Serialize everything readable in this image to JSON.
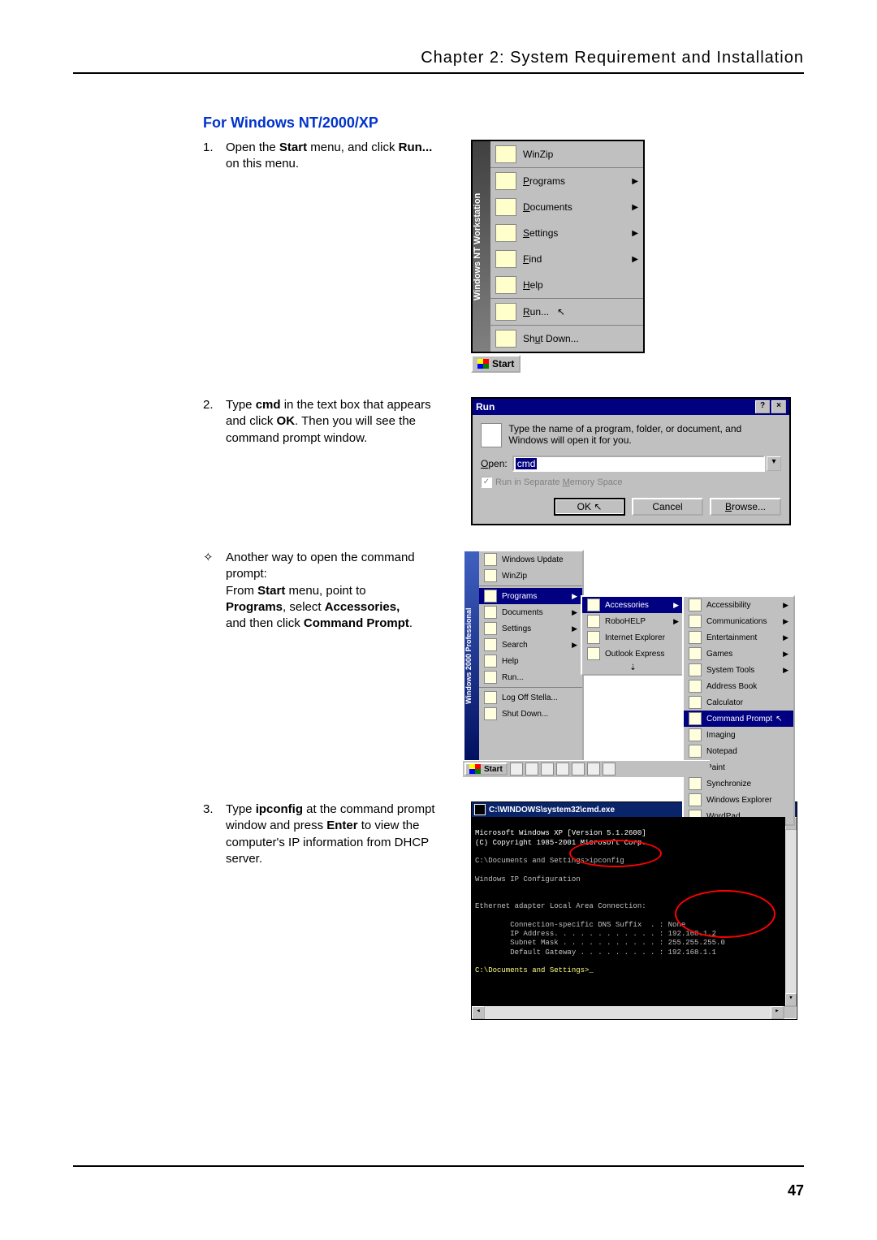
{
  "header": {
    "chapter": "Chapter 2: System Requirement and Installation"
  },
  "section": {
    "title": "For Windows NT/2000/XP"
  },
  "steps": {
    "s1": {
      "num": "1.",
      "pre": "Open the ",
      "b1": "Start",
      "mid": " menu, and click ",
      "b2": "Run...",
      "post": " on this menu."
    },
    "s2": {
      "num": "2.",
      "pre": "Type ",
      "b1": "cmd",
      "mid1": " in the text box that appears and click ",
      "b2": "OK",
      "post": ". Then you will see the command prompt window."
    },
    "tip": {
      "mark": "✧",
      "l1": "Another way to open the command prompt:",
      "l2a": "From ",
      "l2b": "Start",
      "l2c": " menu, point to ",
      "l3a": "Programs",
      "l3b": ", select ",
      "l3c": "Accessories,",
      "l4a": " and then click ",
      "l4b": "Command Prompt",
      "l4c": "."
    },
    "s3": {
      "num": "3.",
      "pre": "Type ",
      "b1": "ipconfig",
      "mid1": " at the command prompt window and press ",
      "b2": "Enter",
      "post": " to view the computer's IP information from DHCP server."
    }
  },
  "nt_menu": {
    "stripe": "Windows NT Workstation",
    "items": [
      {
        "label": "WinZip",
        "arrow": false
      },
      {
        "label": "Programs",
        "arrow": true,
        "ul": "P"
      },
      {
        "label": "Documents",
        "arrow": true,
        "ul": "D"
      },
      {
        "label": "Settings",
        "arrow": true,
        "ul": "S"
      },
      {
        "label": "Find",
        "arrow": true,
        "ul": "F"
      },
      {
        "label": "Help",
        "arrow": false,
        "ul": "H"
      },
      {
        "label": "Run...",
        "arrow": false,
        "ul": "R"
      },
      {
        "label": "Shut Down...",
        "arrow": false,
        "ul": "u"
      }
    ],
    "start": "Start"
  },
  "run": {
    "title": "Run",
    "help": "?",
    "close": "×",
    "desc": "Type the name of a program, folder, or document, and Windows will open it for you.",
    "open_label": "Open:",
    "open_ul": "O",
    "value": "cmd",
    "memchk": "Run in Separate Memory Space",
    "memchk_ul": "M",
    "ok": "OK",
    "cancel": "Cancel",
    "browse": "Browse...",
    "browse_ul": "B"
  },
  "w2k": {
    "stripe": "Windows 2000 Professional",
    "top": [
      {
        "label": "Windows Update"
      },
      {
        "label": "WinZip"
      }
    ],
    "main": [
      {
        "label": "Programs",
        "hi": true,
        "arrow": true
      },
      {
        "label": "Documents",
        "arrow": true
      },
      {
        "label": "Settings",
        "arrow": true
      },
      {
        "label": "Search",
        "arrow": true
      },
      {
        "label": "Help"
      },
      {
        "label": "Run..."
      },
      {
        "label": "Log Off Stella..."
      },
      {
        "label": "Shut Down..."
      }
    ],
    "programs": [
      {
        "label": "Accessories",
        "hi": true,
        "arrow": true
      },
      {
        "label": "RoboHELP",
        "arrow": true
      },
      {
        "label": "Internet Explorer"
      },
      {
        "label": "Outlook Express"
      },
      {
        "label": "⇣"
      }
    ],
    "accessories": [
      {
        "label": "Accessibility",
        "arrow": true
      },
      {
        "label": "Communications",
        "arrow": true
      },
      {
        "label": "Entertainment",
        "arrow": true
      },
      {
        "label": "Games",
        "arrow": true
      },
      {
        "label": "System Tools",
        "arrow": true
      },
      {
        "label": "Address Book"
      },
      {
        "label": "Calculator"
      },
      {
        "label": "Command Prompt",
        "hi": true
      },
      {
        "label": "Imaging"
      },
      {
        "label": "Notepad"
      },
      {
        "label": "Paint"
      },
      {
        "label": "Synchronize"
      },
      {
        "label": "Windows Explorer"
      },
      {
        "label": "WordPad"
      }
    ],
    "start": "Start"
  },
  "cmd": {
    "title": "C:\\WINDOWS\\system32\\cmd.exe",
    "lines": {
      "l1": "Microsoft Windows XP [Version 5.1.2600]",
      "l2": "(C) Copyright 1985-2001 Microsoft Corp.",
      "l3a": "C:\\Documents and Settings>",
      "l3b": "ipconfig",
      "l4": "Windows IP Configuration",
      "l5": "Ethernet adapter Local Area Connection:",
      "l6": "        Connection-specific DNS Suffix  . : None",
      "l7": "        IP Address. . . . . . . . . . . . : 192.168.1.2",
      "l8": "        Subnet Mask . . . . . . . . . . . : 255.255.255.0",
      "l9": "        Default Gateway . . . . . . . . . : 192.168.1.1",
      "l10a": "C:\\Documents and Settings>",
      "l10b": "_"
    }
  },
  "page_number": "47"
}
